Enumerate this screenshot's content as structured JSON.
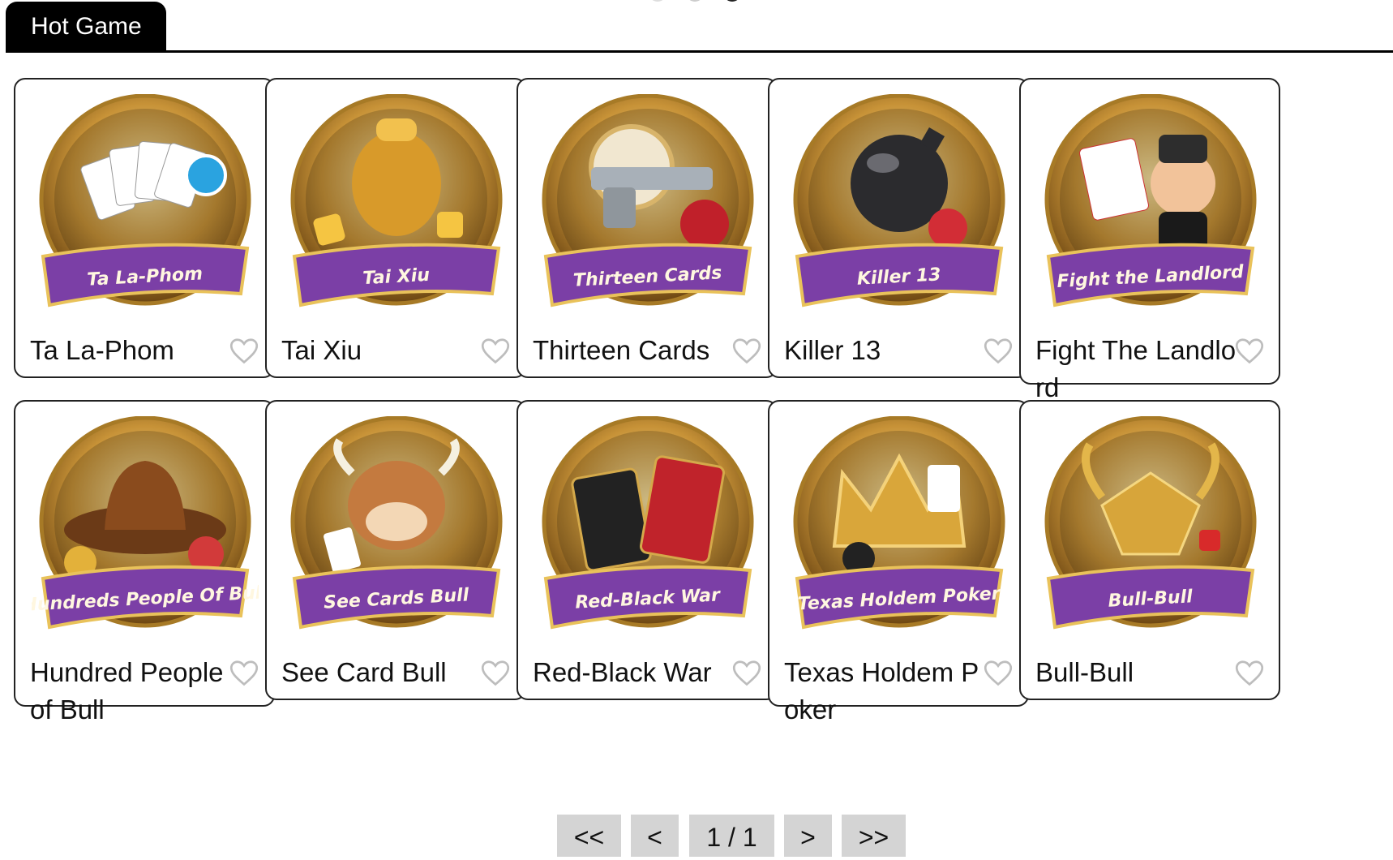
{
  "section": {
    "title": "Hot Game"
  },
  "games": [
    {
      "name": "Ta La-Phom",
      "badge": "Ta La-Phom",
      "art": "phom-cards-chips",
      "accent": "#7b3fa6"
    },
    {
      "name": "Tai Xiu",
      "badge": "Tai Xiu",
      "art": "golden-dice-cup",
      "accent": "#7b3fa6"
    },
    {
      "name": "Thirteen Cards",
      "badge": "Thirteen Cards",
      "art": "revolver-cards",
      "accent": "#7b3fa6"
    },
    {
      "name": "Killer 13",
      "badge": "Killer 13",
      "art": "bomb-cards",
      "accent": "#7b3fa6"
    },
    {
      "name": "Fight The Landlord",
      "badge": "Fight the Landlord",
      "art": "landlord-cigar",
      "accent": "#7b3fa6"
    },
    {
      "name": "Hundred People of Bull",
      "badge": "Hundreds People Of Bull",
      "art": "cowboy-hat",
      "accent": "#7b3fa6"
    },
    {
      "name": "See Card Bull",
      "badge": "See Cards Bull",
      "art": "cartoon-bull",
      "accent": "#7b3fa6"
    },
    {
      "name": "Red-Black War",
      "badge": "Red-Black War",
      "art": "vs-cards",
      "accent": "#7b3fa6"
    },
    {
      "name": "Texas Holdem Poker",
      "badge": "Texas Holdem Poker",
      "art": "golden-crown",
      "accent": "#7b3fa6"
    },
    {
      "name": "Bull-Bull",
      "badge": "Bull-Bull",
      "art": "golden-bull",
      "accent": "#7b3fa6"
    }
  ],
  "favorite_icon": "heart-outline-icon",
  "pagination": {
    "first": "<<",
    "prev": "<",
    "page": "1 / 1",
    "next": ">",
    "last": ">>"
  },
  "colors": {
    "tab_bg": "#000000",
    "badge_purple": "#7b3fa6",
    "gold": "#c9962e",
    "pager_bg": "#d4d4d4"
  }
}
